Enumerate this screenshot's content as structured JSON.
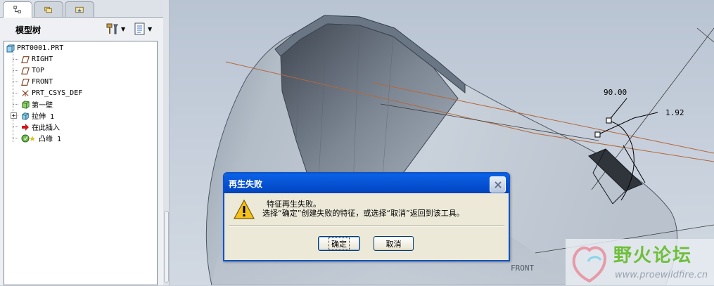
{
  "tabs": [
    {
      "icon": "model-tree-icon"
    },
    {
      "icon": "folder-browser-icon"
    },
    {
      "icon": "favorites-icon"
    }
  ],
  "panel": {
    "title": "模型树",
    "tools": [
      {
        "icon": "show-tools-icon"
      },
      {
        "icon": "tree-settings-icon"
      }
    ]
  },
  "tree": {
    "items": [
      {
        "label": "PRT0001.PRT",
        "icon": "part-icon"
      },
      {
        "label": "RIGHT",
        "icon": "datum-plane-icon"
      },
      {
        "label": "TOP",
        "icon": "datum-plane-icon"
      },
      {
        "label": "FRONT",
        "icon": "datum-plane-icon"
      },
      {
        "label": "PRT_CSYS_DEF",
        "icon": "coordinate-system-icon"
      },
      {
        "label": "第一壁",
        "icon": "first-wall-icon"
      },
      {
        "label": "拉伸 1",
        "icon": "extrude-icon"
      },
      {
        "label": "在此插入",
        "icon": "insert-here-arrow-icon"
      },
      {
        "label": "凸缘 1",
        "icon": "flange-failed-icon"
      }
    ]
  },
  "viewport": {
    "dimension_angle": "90.00",
    "dimension_length": "1.92",
    "datum_label": "FRONT"
  },
  "dialog": {
    "title": "再生失败",
    "message_line1": "特征再生失败。",
    "message_line2": "选择“确定”创建失败的特征，或选择“取消”返回到该工具。",
    "ok_label": "确定",
    "cancel_label": "取消",
    "icon": "warning-icon"
  },
  "watermark": {
    "name": "野火论坛",
    "url": "www.proewildfire.cn"
  },
  "colors": {
    "titlebar": "#0a58dc",
    "model_surface": "#aab5c1",
    "dimension": "#000000",
    "reference_line": "#b4683a"
  }
}
